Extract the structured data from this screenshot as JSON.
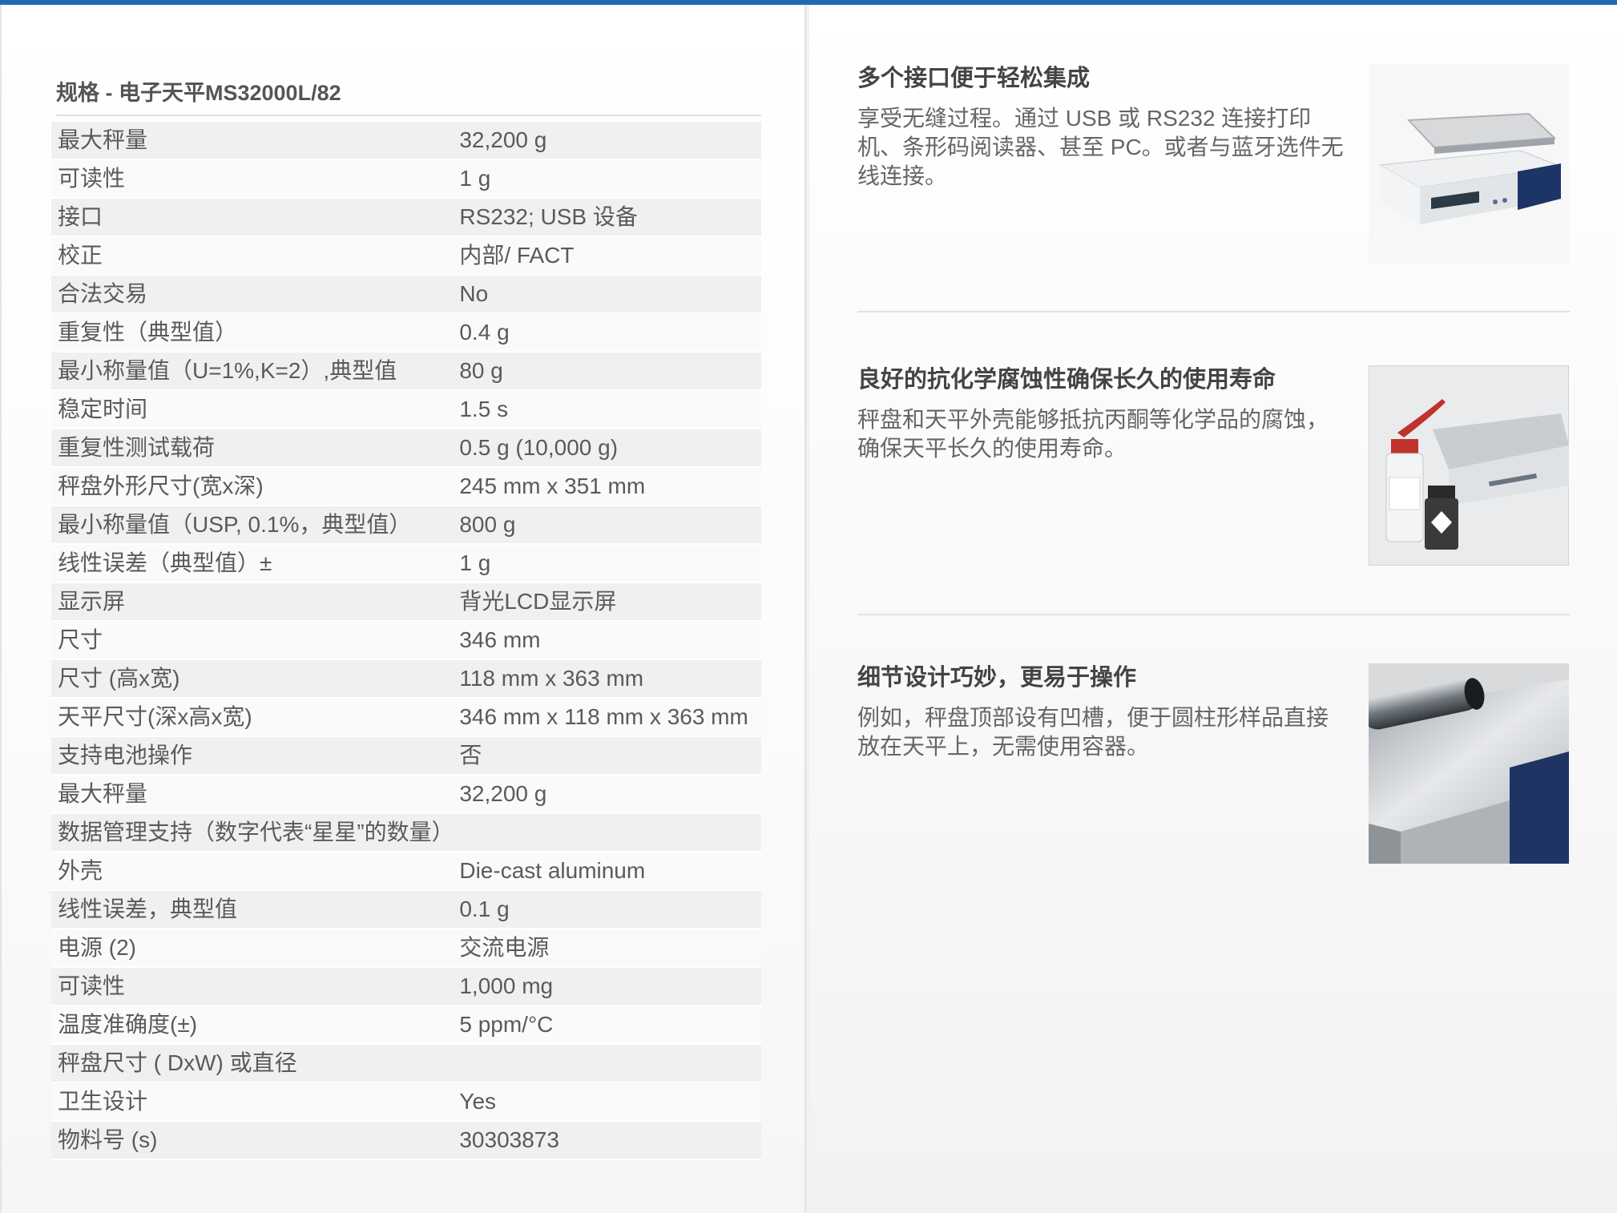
{
  "spec": {
    "title": "规格 - 电子天平MS32000L/82",
    "rows": [
      {
        "k": "最大秤量",
        "v": "32,200 g"
      },
      {
        "k": "可读性",
        "v": "1 g"
      },
      {
        "k": "接口",
        "v": "RS232; USB 设备"
      },
      {
        "k": "校正",
        "v": "内部/ FACT"
      },
      {
        "k": "合法交易",
        "v": "No"
      },
      {
        "k": "重复性（典型值）",
        "v": "0.4 g"
      },
      {
        "k": "最小称量值（U=1%,K=2）,典型值",
        "v": "80 g"
      },
      {
        "k": "稳定时间",
        "v": "1.5 s"
      },
      {
        "k": "重复性测试载荷",
        "v": "0.5 g (10,000 g)"
      },
      {
        "k": "秤盘外形尺寸(宽x深)",
        "v": "245 mm x 351 mm"
      },
      {
        "k": "最小称量值（USP, 0.1%，典型值）",
        "v": "800 g"
      },
      {
        "k": "线性误差（典型值）±",
        "v": "1 g"
      },
      {
        "k": "显示屏",
        "v": "背光LCD显示屏"
      },
      {
        "k": "尺寸",
        "v": "346 mm"
      },
      {
        "k": "尺寸 (高x宽)",
        "v": "118 mm x 363 mm"
      },
      {
        "k": "天平尺寸(深x高x宽)",
        "v": "346 mm x 118 mm x 363 mm"
      },
      {
        "k": "支持电池操作",
        "v": "否"
      },
      {
        "k": "最大秤量",
        "v": "32,200 g"
      },
      {
        "k": "数据管理支持（数字代表“星星”的数量）",
        "v": ""
      },
      {
        "k": "外壳",
        "v": "Die-cast aluminum"
      },
      {
        "k": "线性误差，典型值",
        "v": "0.1 g"
      },
      {
        "k": "电源 (2)",
        "v": "交流电源"
      },
      {
        "k": "可读性",
        "v": "1,000 mg"
      },
      {
        "k": "温度准确度(±)",
        "v": "5 ppm/°C"
      },
      {
        "k": "秤盘尺寸 ( DxW) 或直径",
        "v": ""
      },
      {
        "k": "卫生设计",
        "v": "Yes"
      },
      {
        "k": "物料号 (s)",
        "v": "30303873"
      }
    ]
  },
  "features": [
    {
      "title": "多个接口便于轻松集成",
      "text": "享受无缝过程。通过 USB 或 RS232 连接打印机、条形码阅读器、甚至 PC。或者与蓝牙选件无线连接。",
      "image": "balance-photo"
    },
    {
      "title": "良好的抗化学腐蚀性确保长久的使用寿命",
      "text": "秤盘和天平外壳能够抵抗丙酮等化学品的腐蚀，确保天平长久的使用寿命。",
      "image": "chemical-bottles-photo"
    },
    {
      "title": "细节设计巧妙，更易于操作",
      "text": "例如，秤盘顶部设有凹槽，便于圆柱形样品直接放在天平上，无需使用容器。",
      "image": "pan-groove-photo"
    }
  ],
  "colors": {
    "accent": "#1f6bb0",
    "row_odd": "#f0f0f0",
    "row_even": "#fafafa"
  }
}
